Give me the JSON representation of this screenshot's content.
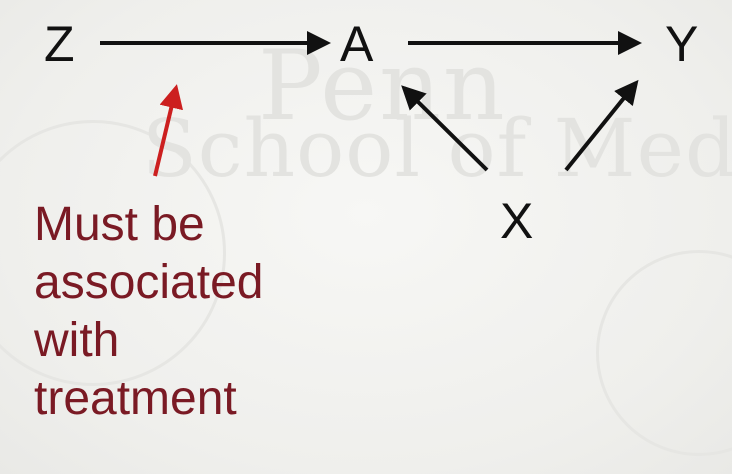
{
  "diagram": {
    "nodes": {
      "z": "Z",
      "a": "A",
      "y": "Y",
      "x": "X"
    },
    "edges": [
      {
        "from": "Z",
        "to": "A"
      },
      {
        "from": "A",
        "to": "Y"
      },
      {
        "from": "X",
        "to": "A"
      },
      {
        "from": "X",
        "to": "Y"
      }
    ],
    "annotation": {
      "lines": [
        "Must be",
        "associated",
        "with",
        "treatment"
      ],
      "color": "#7a1a24",
      "arrow_color": "#cc1f1f"
    }
  },
  "watermark": {
    "line1": "Penn",
    "line2": "School of Medicine"
  }
}
